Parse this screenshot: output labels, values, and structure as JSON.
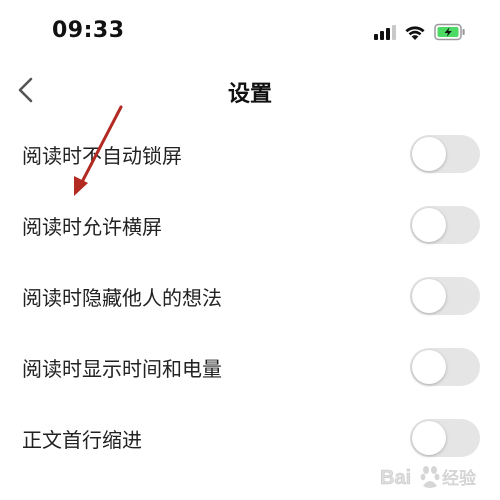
{
  "status_bar": {
    "time": "09:33",
    "icons": [
      "signal-icon",
      "wifi-icon",
      "battery-charging-icon"
    ],
    "battery_color": "#4cd964"
  },
  "nav": {
    "back_icon": "chevron-left-icon",
    "title": "设置"
  },
  "settings": [
    {
      "label": "阅读时不自动锁屏",
      "enabled": false
    },
    {
      "label": "阅读时允许横屏",
      "enabled": false
    },
    {
      "label": "阅读时隐藏他人的想法",
      "enabled": false
    },
    {
      "label": "阅读时显示时间和电量",
      "enabled": false
    },
    {
      "label": "正文首行缩进",
      "enabled": false
    }
  ],
  "colors": {
    "toggle_off": "#e5e5e5",
    "annotation_arrow": "#b22a22"
  },
  "watermark": {
    "brand": "Bai 经验"
  }
}
